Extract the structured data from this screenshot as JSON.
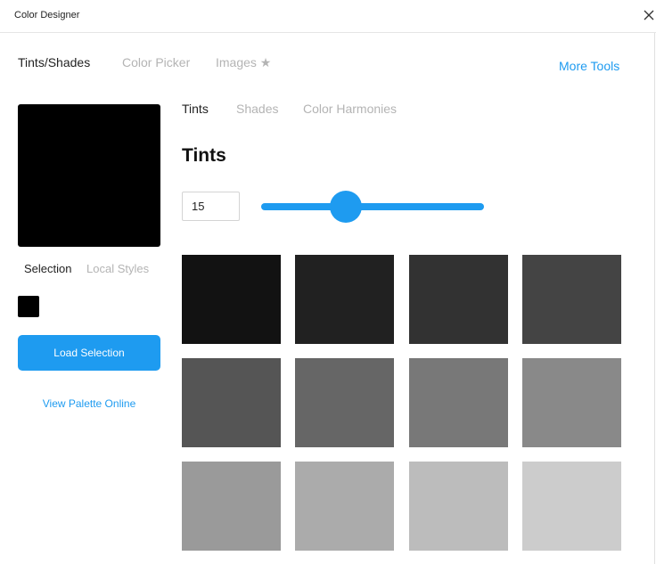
{
  "window": {
    "title": "Color Designer"
  },
  "main_tabs": [
    {
      "label": "Tints/Shades",
      "active": true
    },
    {
      "label": "Color Picker",
      "active": false
    },
    {
      "label": "Images ★",
      "active": false
    }
  ],
  "more_tools_label": "More Tools",
  "left_panel": {
    "preview_color": "#000000",
    "tabs": [
      {
        "label": "Selection",
        "active": true
      },
      {
        "label": "Local Styles",
        "active": false
      }
    ],
    "swatch_color": "#000000",
    "load_button_label": "Load Selection",
    "view_palette_label": "View Palette Online"
  },
  "sub_tabs": [
    {
      "label": "Tints",
      "active": true
    },
    {
      "label": "Shades",
      "active": false
    },
    {
      "label": "Color Harmonies",
      "active": false
    }
  ],
  "heading": "Tints",
  "tint_input_value": "15",
  "slider": {
    "value_fraction": 0.38
  },
  "colors": {
    "accent": "#1e9bf0",
    "text_active": "#222222",
    "text_inactive": "#b4b4b4"
  },
  "tints": [
    "#121212",
    "#212121",
    "#323232",
    "#444444",
    "#555555",
    "#666666",
    "#787878",
    "#898989",
    "#9a9a9a",
    "#ababab",
    "#bcbcbc",
    "#cccccc"
  ]
}
